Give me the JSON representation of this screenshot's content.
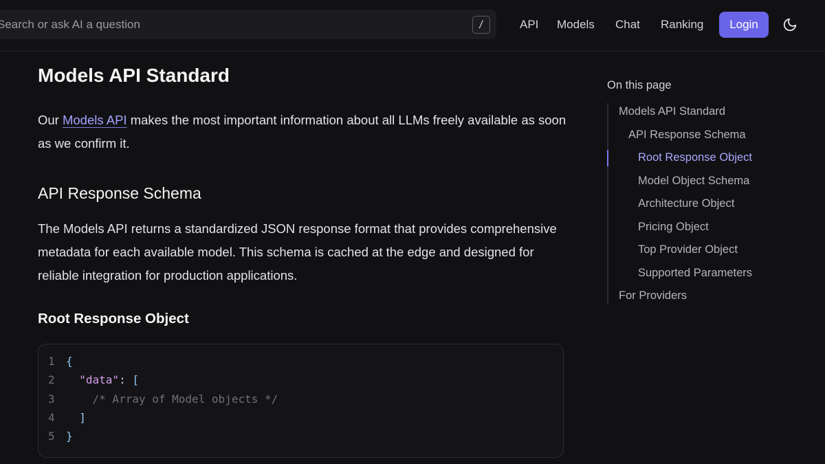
{
  "header": {
    "search_placeholder": "Search or ask AI a question",
    "search_shortcut": "/",
    "nav": [
      {
        "label": "API"
      },
      {
        "label": "Models"
      },
      {
        "label": "Chat"
      },
      {
        "label": "Ranking"
      }
    ],
    "login_label": "Login",
    "theme_icon": "moon-icon",
    "accent_color": "#6a64e8"
  },
  "main": {
    "title": "Models API Standard",
    "intro": {
      "link_text": "Models API",
      "before": "Our ",
      "after": " makes the most important information about all LLMs freely available as soon as we confirm it."
    },
    "section_title": "API Response Schema",
    "section_body": "The Models API returns a standardized JSON response format that provides comprehensive metadata for each available model. This schema is cached at the edge and designed for reliable integration for production applications.",
    "subsection_title": "Root Response Object",
    "code": {
      "lines": [
        {
          "num": "1",
          "text": "{"
        },
        {
          "num": "2",
          "key": "\"data\"",
          "colon": ": ",
          "bracket": "["
        },
        {
          "num": "3",
          "comment": "/* Array of Model objects */"
        },
        {
          "num": "4",
          "text": "]"
        },
        {
          "num": "5",
          "text": "}"
        }
      ]
    }
  },
  "toc": {
    "title": "On this page",
    "items": [
      {
        "label": "Models API Standard",
        "level": 0
      },
      {
        "label": "API Response Schema",
        "level": 1
      },
      {
        "label": "Root Response Object",
        "level": 2,
        "active": true
      },
      {
        "label": "Model Object Schema",
        "level": 2
      },
      {
        "label": "Architecture Object",
        "level": 2
      },
      {
        "label": "Pricing Object",
        "level": 2
      },
      {
        "label": "Top Provider Object",
        "level": 2
      },
      {
        "label": "Supported Parameters",
        "level": 2
      },
      {
        "label": "For Providers",
        "level": 0
      }
    ]
  }
}
